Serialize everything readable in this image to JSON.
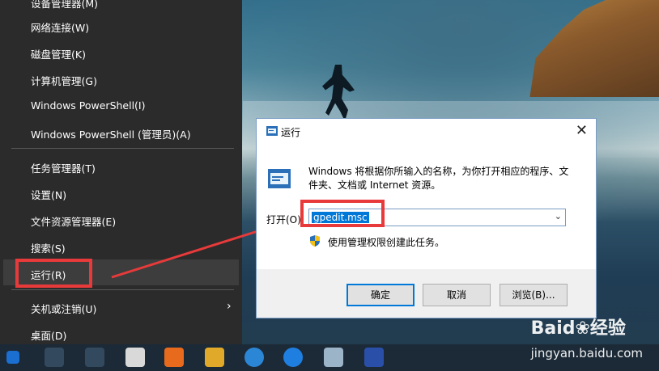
{
  "start_menu": {
    "items": [
      {
        "label": "设备管理器(M)",
        "name": "menu-item-device-manager"
      },
      {
        "label": "网络连接(W)",
        "name": "menu-item-network"
      },
      {
        "label": "磁盘管理(K)",
        "name": "menu-item-disk"
      },
      {
        "label": "计算机管理(G)",
        "name": "menu-item-computer-management"
      },
      {
        "label": "Windows PowerShell(I)",
        "name": "menu-item-powershell"
      },
      {
        "label": "Windows PowerShell (管理员)(A)",
        "name": "menu-item-powershell-admin"
      },
      {
        "label": "任务管理器(T)",
        "name": "menu-item-task-manager"
      },
      {
        "label": "设置(N)",
        "name": "menu-item-settings"
      },
      {
        "label": "文件资源管理器(E)",
        "name": "menu-item-explorer"
      },
      {
        "label": "搜索(S)",
        "name": "menu-item-search"
      },
      {
        "label": "运行(R)",
        "name": "menu-item-run"
      },
      {
        "label": "关机或注销(U)",
        "name": "menu-item-shutdown"
      },
      {
        "label": "桌面(D)",
        "name": "menu-item-desktop"
      }
    ],
    "highlighted": "运行(R)"
  },
  "run_dialog": {
    "title": "运行",
    "description": "Windows 将根据你所输入的名称，为你打开相应的程序、文件夹、文档或 Internet 资源。",
    "open_label": "打开(O):",
    "input_value": "gpedit.msc",
    "admin_note": "使用管理权限创建此任务。",
    "buttons": {
      "ok": "确定",
      "cancel": "取消",
      "browse": "浏览(B)..."
    }
  },
  "watermark": {
    "brand": "Baid❀经验",
    "url": "jingyan.baidu.com"
  },
  "colors": {
    "annotation": "#e83a3a",
    "menu_bg": "#2b2b2b",
    "accent": "#0078d7"
  }
}
